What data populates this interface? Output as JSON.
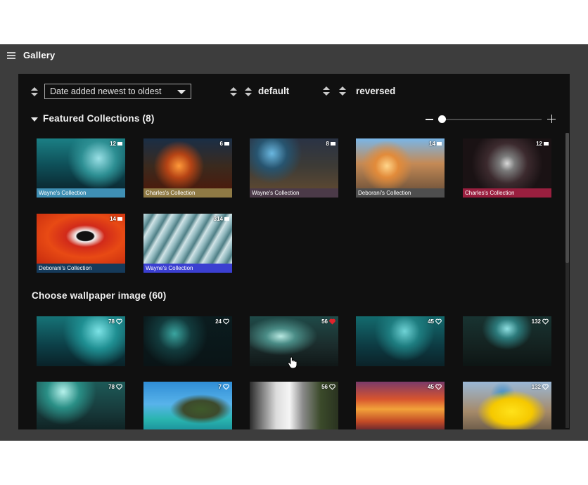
{
  "app": {
    "title": "Gallery"
  },
  "toolbar": {
    "sort_select": "Date added newest to oldest",
    "sort_option_2": "default",
    "sort_option_3": "reversed"
  },
  "featured": {
    "title": "Featured Collections (8)",
    "collections": [
      {
        "label": "Wayne's Collection",
        "count": "12",
        "color": "#3f8fb4"
      },
      {
        "label": "Charles's Collection",
        "count": "6",
        "color": "#8f7a45"
      },
      {
        "label": "Wayne's Collection",
        "count": "8",
        "color": "#4b3a48"
      },
      {
        "label": "Deborani's Collection",
        "count": "14",
        "color": "#4e4e4e"
      },
      {
        "label": "Charles's Collection",
        "count": "12",
        "color": "#9a1f3f"
      },
      {
        "label": "Deborani's Collection",
        "count": "14",
        "color": "#153a5a"
      },
      {
        "label": "Wayne's Collection",
        "count": "314",
        "color": "#3b3fd1"
      }
    ]
  },
  "wallpapers": {
    "title": "Choose wallpaper image (60)",
    "items": [
      {
        "likes": "78",
        "liked": false
      },
      {
        "likes": "24",
        "liked": false
      },
      {
        "likes": "56",
        "liked": true
      },
      {
        "likes": "45",
        "liked": false
      },
      {
        "likes": "132",
        "liked": false
      },
      {
        "likes": "78",
        "liked": false
      },
      {
        "likes": "7",
        "liked": false
      },
      {
        "likes": "56",
        "liked": false
      },
      {
        "likes": "45",
        "liked": false
      },
      {
        "likes": "132",
        "liked": false
      }
    ]
  },
  "colors": {
    "liked_heart": "#e0242c",
    "panel_bg": "#101010",
    "window_bg": "#3d3d3d"
  }
}
